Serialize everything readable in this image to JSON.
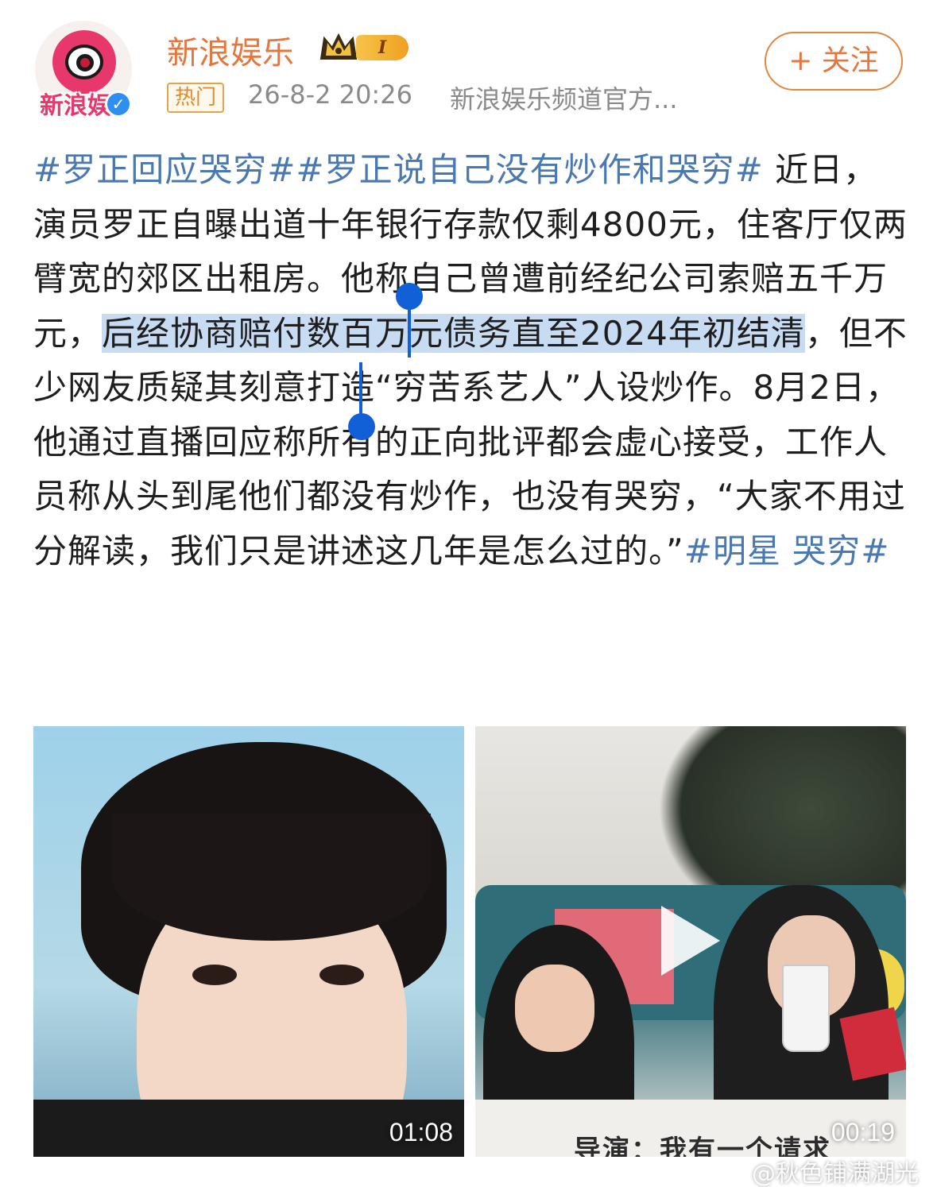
{
  "header": {
    "avatar_text": "新浪娱",
    "username": "新浪娱乐",
    "rank_level": "I",
    "hot_tag": "热门",
    "timestamp": "26-8-2 20:26",
    "source": "新浪娱乐频道官方...",
    "follow_label": "+ 关注"
  },
  "post": {
    "hashtag_1": "#罗正回应哭穷#",
    "hashtag_2": "#罗正说自己没有炒作和哭穷#",
    "text_before": " 近日，演员罗正自曝出道十年银行存款仅剩4800元，住客厅仅两臂宽的郊区出租房。他称自己曾遭前经纪公司索赔五千万元，",
    "text_selected": "后经协商赔付数百万元债务直至2024年初结清",
    "text_after": "，但不少网友质疑其刻意打造“穷苦系艺人”人设炒作。8月2日，他通过直播回应称所有的正向批评都会虚心接受，工作人员称从头到尾他们都没有炒作，也没有哭穷，“大家不用过分解读，我们只是讲述这几年是怎么过的。”",
    "hashtag_3": "#明星 哭穷#"
  },
  "videos": [
    {
      "duration": "01:08"
    },
    {
      "duration": "00:19",
      "subtitle": "导演：我有一个请求"
    }
  ],
  "watermark": "@秋色铺满湖光",
  "colors": {
    "accent": "#e5763e",
    "hashtag": "#4a78b0",
    "selection": "#c7dbf2",
    "selection_handle": "#1160d8"
  }
}
